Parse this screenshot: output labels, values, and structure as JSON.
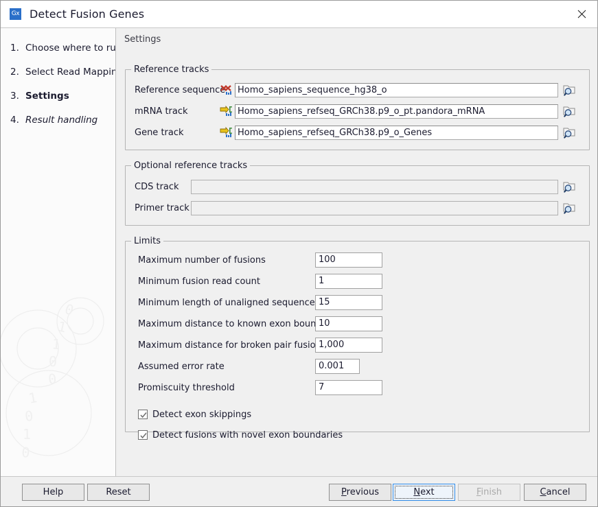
{
  "window": {
    "title": "Detect Fusion Genes",
    "app_icon_label": "Gx",
    "close_icon": "close-icon"
  },
  "sidebar": {
    "steps": [
      {
        "num": "1.",
        "label": "Choose where to run",
        "state": "done"
      },
      {
        "num": "2.",
        "label": "Select Read Mapping",
        "state": "done"
      },
      {
        "num": "3.",
        "label": "Settings",
        "state": "current"
      },
      {
        "num": "4.",
        "label": "Result handling",
        "state": "pending"
      }
    ]
  },
  "main": {
    "heading": "Settings",
    "reference_tracks": {
      "legend": "Reference tracks",
      "rows": [
        {
          "label": "Reference sequence",
          "icon": "sequence-track-icon",
          "value": "Homo_sapiens_sequence_hg38_o",
          "browse_icon": "browse-folder-icon"
        },
        {
          "label": "mRNA track",
          "icon": "annotation-track-icon",
          "value": "Homo_sapiens_refseq_GRCh38.p9_o_pt.pandora_mRNA",
          "browse_icon": "browse-folder-icon"
        },
        {
          "label": "Gene track",
          "icon": "annotation-track-icon",
          "value": "Homo_sapiens_refseq_GRCh38.p9_o_Genes",
          "browse_icon": "browse-folder-icon"
        }
      ]
    },
    "optional_reference_tracks": {
      "legend": "Optional reference tracks",
      "rows": [
        {
          "label": "CDS track",
          "value": "",
          "browse_icon": "browse-folder-icon"
        },
        {
          "label": "Primer track",
          "value": "",
          "browse_icon": "browse-folder-icon"
        }
      ]
    },
    "limits": {
      "legend": "Limits",
      "fields": [
        {
          "label": "Maximum number of fusions",
          "value": "100"
        },
        {
          "label": "Minimum fusion read count",
          "value": "1"
        },
        {
          "label": "Minimum length of unaligned sequence",
          "value": "15"
        },
        {
          "label": "Maximum distance to known exon boundary",
          "value": "10"
        },
        {
          "label": "Maximum distance for broken pair fusions",
          "value": "1,000"
        },
        {
          "label": "Assumed error rate",
          "value": "0.001"
        },
        {
          "label": "Promiscuity threshold",
          "value": "7"
        }
      ],
      "checkboxes": [
        {
          "label": "Detect exon skippings",
          "checked": true
        },
        {
          "label": "Detect fusions with novel exon boundaries",
          "checked": true
        }
      ]
    }
  },
  "buttons": {
    "help": {
      "label": "Help",
      "mnemonic": "",
      "enabled": true,
      "focused": false
    },
    "reset": {
      "label": "Reset",
      "mnemonic": "",
      "enabled": true,
      "focused": false
    },
    "previous": {
      "label": "Previous",
      "mnemonic": "P",
      "enabled": true,
      "focused": false
    },
    "next": {
      "label": "Next",
      "mnemonic": "N",
      "enabled": true,
      "focused": true
    },
    "finish": {
      "label": "Finish",
      "mnemonic": "F",
      "enabled": false,
      "focused": false
    },
    "cancel": {
      "label": "Cancel",
      "mnemonic": "C",
      "enabled": true,
      "focused": false
    }
  },
  "colors": {
    "accent": "#2a6fc9",
    "focus_border": "#2e8ae6",
    "panel_bg": "#f0f0f0",
    "field_bg": "#ffffff",
    "sidebar_bg": "#fbfbfb"
  }
}
